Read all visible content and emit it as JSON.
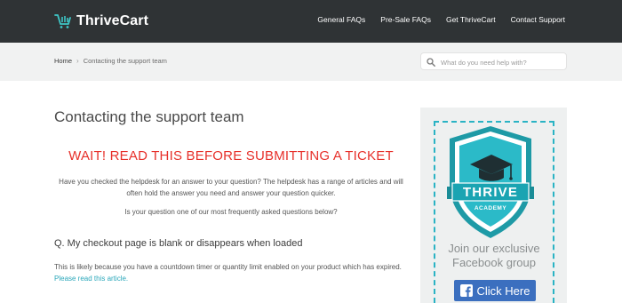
{
  "header": {
    "brand": "ThriveCart",
    "nav": [
      "General FAQs",
      "Pre-Sale FAQs",
      "Get ThriveCart",
      "Contact Support"
    ]
  },
  "breadcrumb": {
    "home": "Home",
    "separator": "›",
    "current": "Contacting the support team"
  },
  "search": {
    "placeholder": "What do you need help with?",
    "value": ""
  },
  "article": {
    "title": "Contacting the support team",
    "warning": "WAIT! READ THIS BEFORE SUBMITTING A TICKET",
    "intro": "Have you checked the helpdesk for an answer to your question? The helpdesk has a range of articles and will often hold the answer you need and answer your question quicker.",
    "question": "Is your question one of our most frequently asked questions below?",
    "faq": {
      "title": "Q. My checkout page is blank or disappears when loaded",
      "body": "This is likely because you have a countdown timer or quantity limit enabled on your product which has expired.",
      "link": "Please read this article."
    }
  },
  "sidebar": {
    "badge_title": "THRIVE",
    "badge_sub": "ACADEMY",
    "text": "Join our exclusive Facebook group",
    "button": "Click Here"
  },
  "colors": {
    "topbar": "#2f3335",
    "accent": "#2ab3c4",
    "warning": "#e7312b",
    "link": "#2aa7ba",
    "facebook": "#3b6fbf"
  }
}
